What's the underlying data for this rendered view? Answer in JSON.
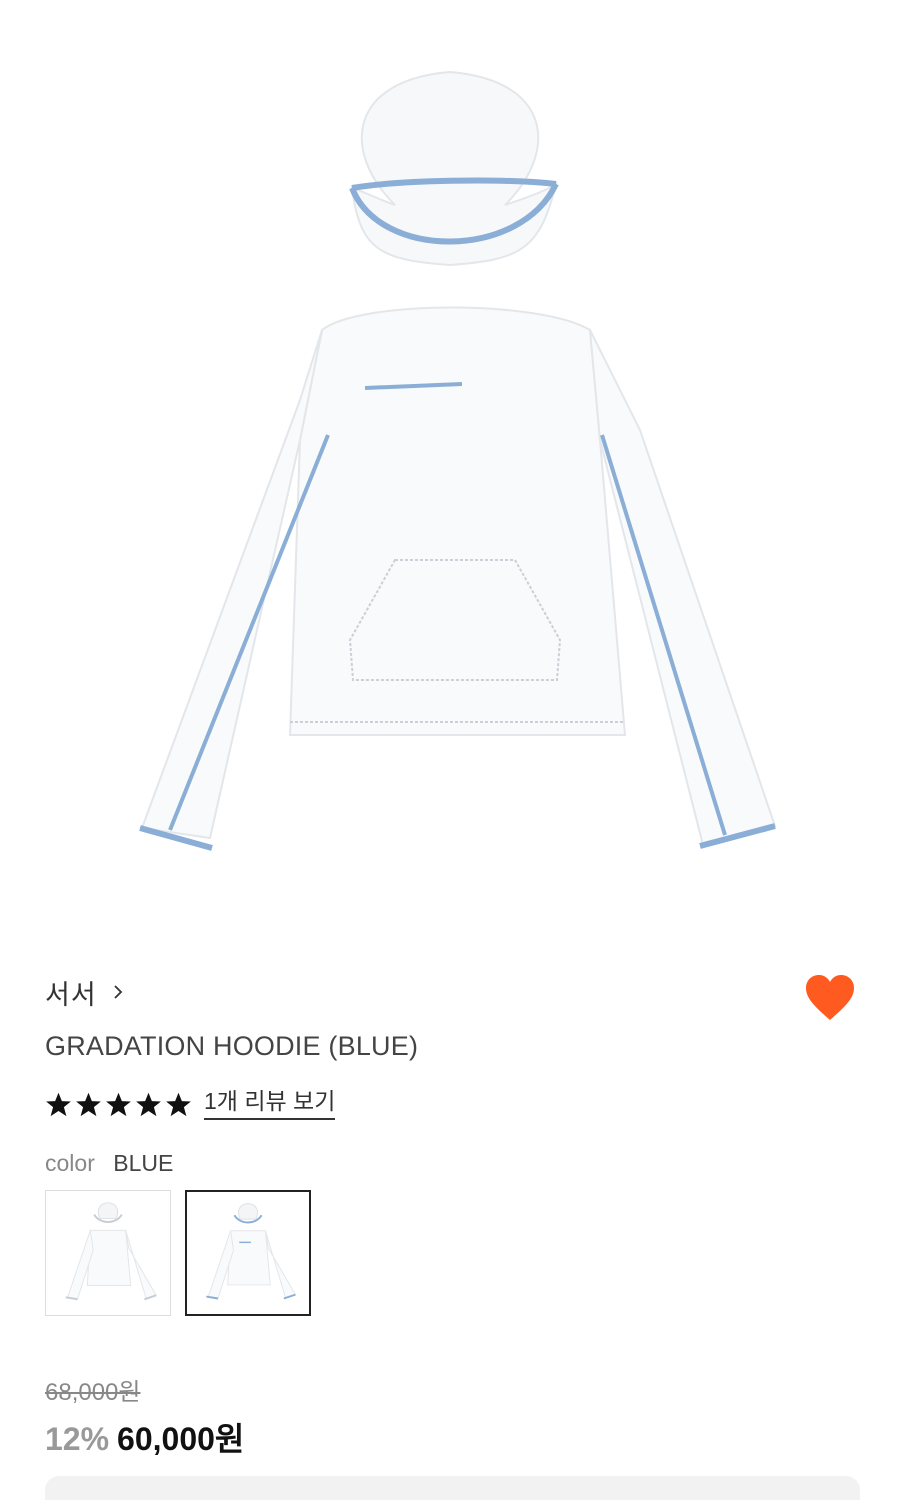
{
  "product": {
    "image_alt": "GRADATION HOODIE (BLUE) product image",
    "brand": "서서",
    "title": "GRADATION HOODIE (BLUE)",
    "rating": 5,
    "rating_max": 5,
    "review_link": "1개 리뷰 보기",
    "color_label": "color",
    "color_value": "BLUE",
    "swatches": [
      {
        "name": "swatch-1",
        "selected": false
      },
      {
        "name": "swatch-2",
        "selected": true
      }
    ],
    "original_price": "68,000원",
    "discount": "12%",
    "price": "60,000원",
    "wishlisted": true
  },
  "colors": {
    "heart": "#ff5a1f",
    "trim_blue": "#8aaed6",
    "star": "#111111"
  },
  "icons": {
    "brand_chevron": "chevron-right-icon",
    "wishlist": "heart-icon",
    "rating": "star-icon"
  }
}
